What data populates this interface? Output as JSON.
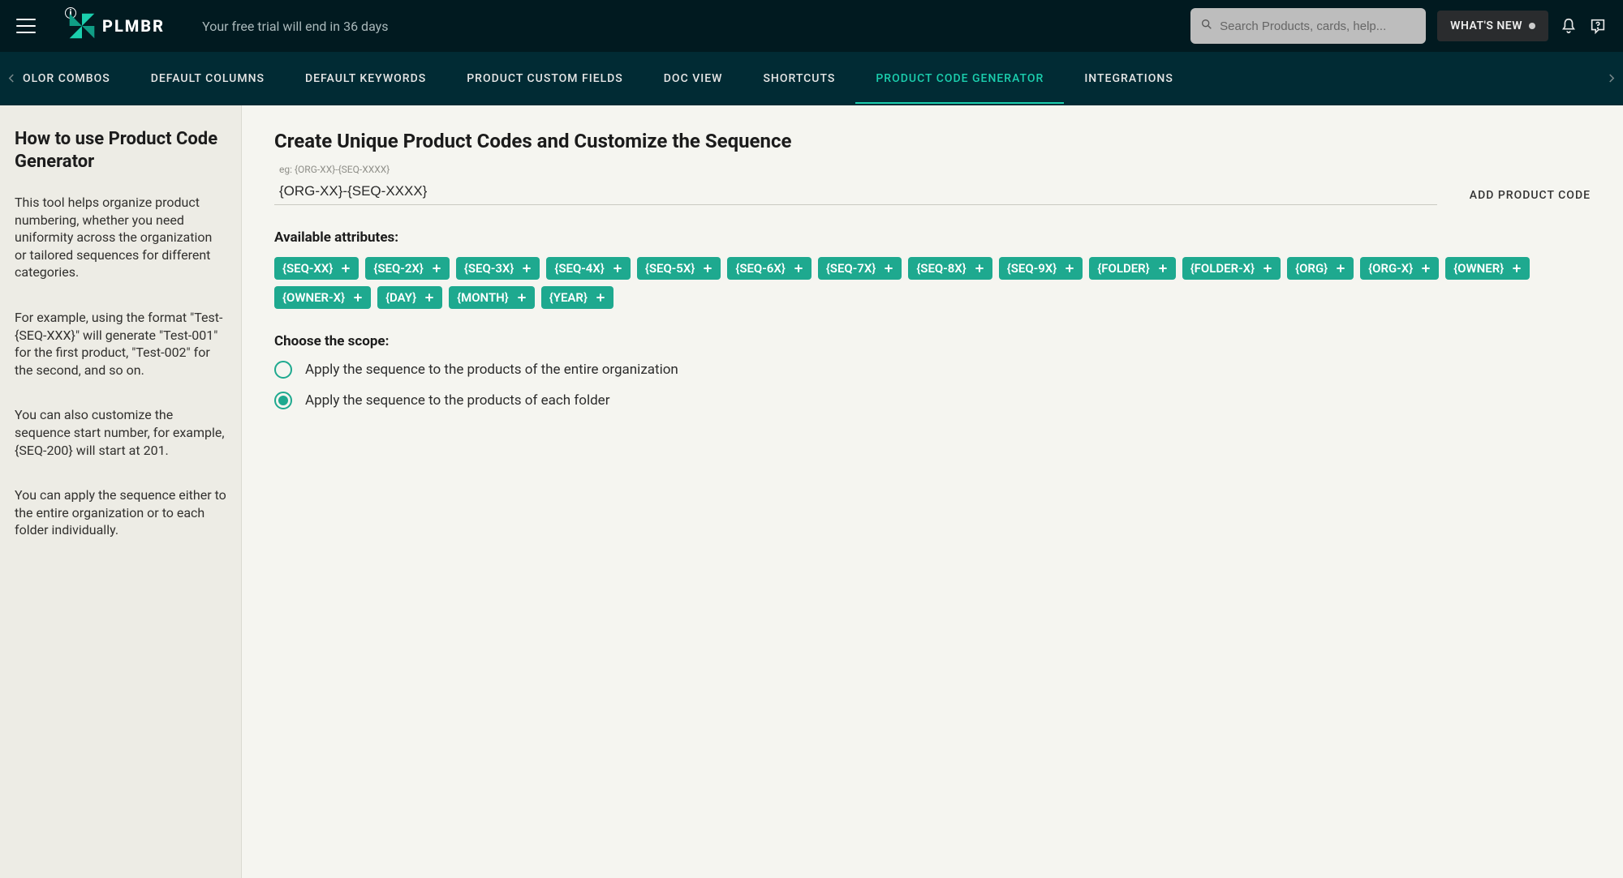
{
  "header": {
    "brand": "PLMBR",
    "trial_text": "Your free trial will end in 36 days",
    "search_placeholder": "Search Products, cards, help...",
    "whats_new_label": "WHAT'S NEW"
  },
  "nav": {
    "tabs": [
      {
        "label": "OLOR COMBOS",
        "partial": true
      },
      {
        "label": "DEFAULT COLUMNS"
      },
      {
        "label": "DEFAULT KEYWORDS"
      },
      {
        "label": "PRODUCT CUSTOM FIELDS"
      },
      {
        "label": "DOC VIEW"
      },
      {
        "label": "SHORTCUTS"
      },
      {
        "label": "PRODUCT CODE GENERATOR",
        "active": true
      },
      {
        "label": "INTEGRATIONS"
      }
    ]
  },
  "sidebar": {
    "title": "How to use Product Code Generator",
    "paragraphs": [
      "This tool helps organize product numbering, whether you need uniformity across the organization or tailored sequences for different categories.",
      "For example, using the format \"Test-{SEQ-XXX}\" will generate \"Test-001\" for the first product, \"Test-002\" for the second, and so on.",
      "You can also customize the sequence start number, for example, {SEQ-200} will start at 201.",
      "You can apply the sequence either to the entire organization or to each folder individually."
    ]
  },
  "main": {
    "title": "Create Unique Product Codes and Customize the Sequence",
    "example_label": "eg: {ORG-XX}-{SEQ-XXXX}",
    "code_input_value": "{ORG-XX}-{SEQ-XXXX}",
    "add_button_label": "ADD PRODUCT CODE",
    "attributes_label": "Available attributes:",
    "attributes": [
      "{SEQ-XX}",
      "{SEQ-2X}",
      "{SEQ-3X}",
      "{SEQ-4X}",
      "{SEQ-5X}",
      "{SEQ-6X}",
      "{SEQ-7X}",
      "{SEQ-8X}",
      "{SEQ-9X}",
      "{FOLDER}",
      "{FOLDER-X}",
      "{ORG}",
      "{ORG-X}",
      "{OWNER}",
      "{OWNER-X}",
      "{DAY}",
      "{MONTH}",
      "{YEAR}"
    ],
    "scope_label": "Choose the scope:",
    "scope_options": [
      {
        "label": "Apply the sequence to the products of the entire organization",
        "selected": false
      },
      {
        "label": "Apply the sequence to the products of each folder",
        "selected": true
      }
    ]
  }
}
